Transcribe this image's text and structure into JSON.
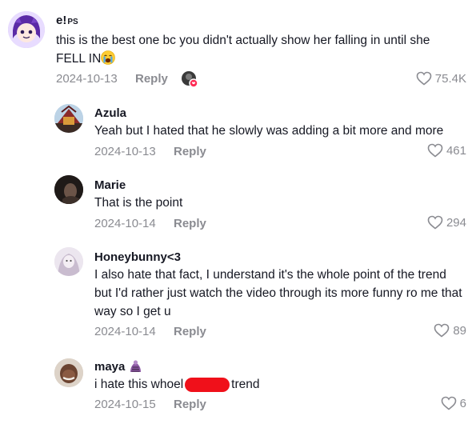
{
  "comments": [
    {
      "username": "e!",
      "username_suffix": "PS",
      "text": "this is the best one bc you didn't actually show her falling in until she FELL IN",
      "emoji": "crying-face",
      "date": "2024-10-13",
      "reply_label": "Reply",
      "likes": "75.4K"
    },
    {
      "username": "Azula",
      "text": "Yeah but I hated that he slowly was adding a bit more and more",
      "date": "2024-10-13",
      "reply_label": "Reply",
      "likes": "461"
    },
    {
      "username": "Marie",
      "text": "That is the point",
      "date": "2024-10-14",
      "reply_label": "Reply",
      "likes": "294"
    },
    {
      "username": "Honeybunny<3",
      "text": "I also hate that fact, I understand it's the whole point of the trend but I'd rather just watch the video through its more funny ro me that way so I get u",
      "date": "2024-10-14",
      "reply_label": "Reply",
      "likes": "89"
    },
    {
      "username": "maya",
      "text_before": "i hate this whoel",
      "text_after": "trend",
      "date": "2024-10-15",
      "reply_label": "Reply",
      "likes": "6"
    }
  ]
}
